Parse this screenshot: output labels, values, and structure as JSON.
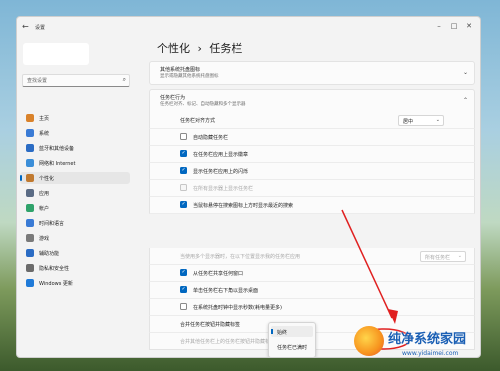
{
  "window": {
    "title": "设置",
    "back_icon": "back-arrow-icon",
    "controls": [
      "minimize-icon",
      "maximize-icon",
      "close-icon"
    ]
  },
  "sidebar": {
    "search": {
      "placeholder": "查找设置"
    },
    "items": [
      {
        "label": "主页",
        "icon": "home-icon",
        "color": "#d9822b",
        "active": false
      },
      {
        "label": "系统",
        "icon": "system-icon",
        "color": "#3a7bd5",
        "active": false
      },
      {
        "label": "蓝牙和其他设备",
        "icon": "bluetooth-icon",
        "color": "#2b6cc4",
        "active": false
      },
      {
        "label": "网络和 Internet",
        "icon": "network-icon",
        "color": "#3b8ed8",
        "active": false
      },
      {
        "label": "个性化",
        "icon": "personalization-icon",
        "color": "#c0792f",
        "active": true
      },
      {
        "label": "应用",
        "icon": "apps-icon",
        "color": "#5a6b84",
        "active": false
      },
      {
        "label": "帐户",
        "icon": "account-icon",
        "color": "#2fa36b",
        "active": false
      },
      {
        "label": "时间和语言",
        "icon": "time-language-icon",
        "color": "#3a7bd5",
        "active": false
      },
      {
        "label": "游戏",
        "icon": "gaming-icon",
        "color": "#7a7a7a",
        "active": false
      },
      {
        "label": "辅助功能",
        "icon": "accessibility-icon",
        "color": "#2b6cc4",
        "active": false
      },
      {
        "label": "隐私和安全性",
        "icon": "privacy-icon",
        "color": "#6b6b6b",
        "active": false
      },
      {
        "label": "Windows 更新",
        "icon": "windows-update-icon",
        "color": "#1f7ad8",
        "active": false
      }
    ]
  },
  "main": {
    "breadcrumb": {
      "parent": "个性化",
      "separator": "›",
      "current": "任务栏"
    },
    "tray_card": {
      "title": "其他系统托盘图标",
      "subtitle": "显示或隐藏其他系统托盘图标"
    },
    "behavior_card": {
      "title": "任务栏行为",
      "subtitle": "任务栏对齐、标记、自动隐藏和多个显示器"
    },
    "alignment": {
      "label": "任务栏对齐方式",
      "value": "居中"
    },
    "options": [
      {
        "label": "自动隐藏任务栏",
        "checked": false,
        "disabled": false
      },
      {
        "label": "在任务栏应用上显示徽章",
        "checked": true,
        "disabled": false
      },
      {
        "label": "显示任务栏应用上的闪烁",
        "checked": true,
        "disabled": false
      },
      {
        "label": "在所有显示器上显示任务栏",
        "checked": false,
        "disabled": true
      },
      {
        "label": "当鼠标悬停在搜索图标上方时显示最近的搜索",
        "checked": true,
        "disabled": false
      }
    ],
    "multi_monitor": {
      "label": "当使用多个显示器时，在以下位置显示我的任务栏应用",
      "value": "所有任务栏"
    },
    "options2": [
      {
        "label": "从任务栏共享任何窗口",
        "checked": true,
        "disabled": false
      },
      {
        "label": "单击任务栏右下角以显示桌面",
        "checked": true,
        "disabled": false
      },
      {
        "label": "在系统托盘时钟中显示秒数(耗电量更多)",
        "checked": false,
        "disabled": false
      }
    ],
    "combine": {
      "label": "合并任务栏按钮并隐藏标签"
    },
    "combine_other": {
      "label": "合并其他任务栏上的任务栏按钮并隐藏标签"
    },
    "combine_menu": {
      "items": [
        "始终",
        "任务栏已满时"
      ],
      "selected": 0
    }
  },
  "watermark": {
    "main": "纯净系统家园",
    "url": "www.yidaimei.com"
  },
  "colors": {
    "accent": "#0067c0",
    "annotation": "#e02020"
  }
}
